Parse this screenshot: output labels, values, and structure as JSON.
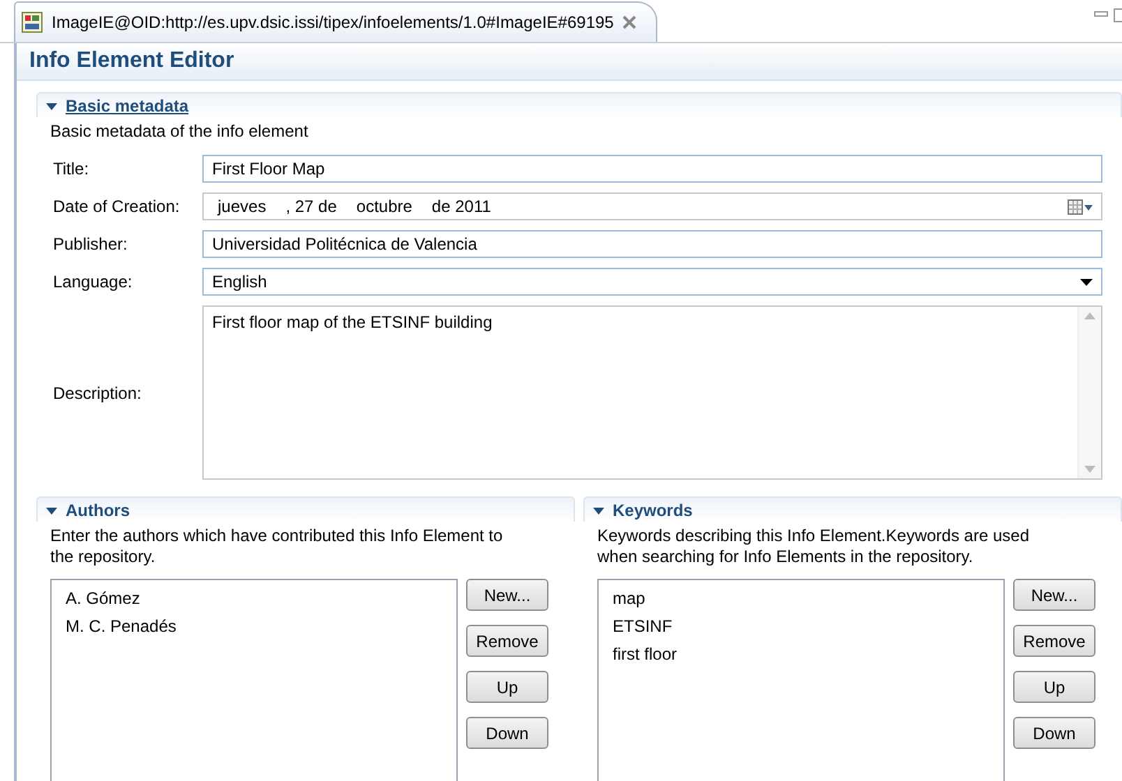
{
  "tab": {
    "title": "ImageIE@OID:http://es.upv.dsic.issi/tipex/infoelements/1.0#ImageIE#69195"
  },
  "editor": {
    "title": "Info Element Editor"
  },
  "basic": {
    "title": "Basic metadata",
    "expanded": true,
    "description": "Basic metadata of the info element",
    "fields": [
      {
        "kind": "text",
        "label": "Title:",
        "value": "First Floor Map"
      },
      {
        "kind": "date",
        "label": "Date of Creation:",
        "parts": [
          "jueves",
          ", 27 de",
          "octubre",
          "de 2011"
        ]
      },
      {
        "kind": "text",
        "label": "Publisher:",
        "value": "Universidad Politécnica de Valencia"
      },
      {
        "kind": "dropdown",
        "label": "Language:",
        "value": "English"
      },
      {
        "kind": "textarea",
        "label": "Description:",
        "value": "First floor map of the ETSINF building"
      }
    ]
  },
  "lists": [
    {
      "title": "Authors",
      "expanded": true,
      "description": "Enter the authors which have contributed this Info Element to the repository.",
      "items": [
        "A. Gómez",
        "M. C. Penadés"
      ],
      "buttons": [
        "New...",
        "Remove",
        "Up",
        "Down"
      ]
    },
    {
      "title": "Keywords",
      "expanded": true,
      "description": "Keywords describing this Info Element.Keywords are used when searching for Info Elements in the repository.",
      "items": [
        "map",
        "ETSINF",
        "first floor"
      ],
      "buttons": [
        "New...",
        "Remove",
        "Up",
        "Down"
      ]
    }
  ]
}
